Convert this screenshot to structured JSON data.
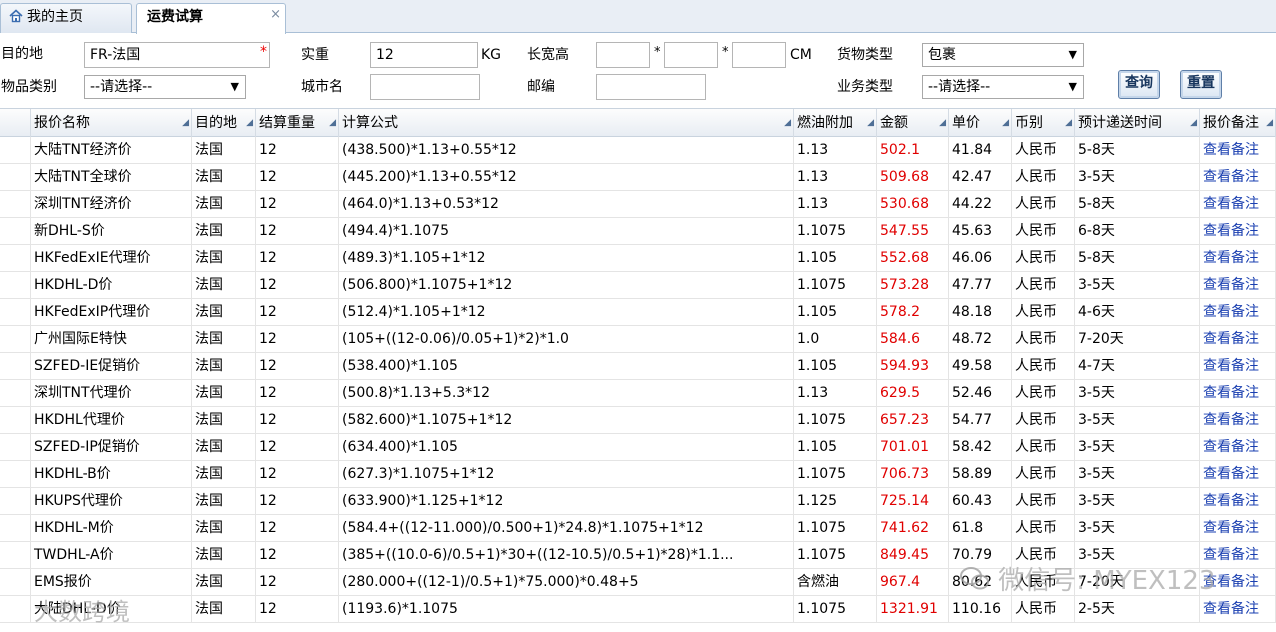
{
  "tabs": [
    {
      "label": "我的主页"
    },
    {
      "label": "运费试算",
      "close": "×"
    }
  ],
  "form": {
    "destination_label": "目的地",
    "destination_value": "FR-法国",
    "required_mark": "*",
    "weight_label": "实重",
    "weight_value": "12",
    "weight_unit": "KG",
    "dims_label": "长宽高",
    "dims_sep": "*",
    "dims_unit": "CM",
    "goods_type_label": "货物类型",
    "goods_type_value": "包裹",
    "item_category_label": "物品类别",
    "item_category_value": "--请选择--",
    "city_label": "城市名",
    "postcode_label": "邮编",
    "business_type_label": "业务类型",
    "business_type_value": "--请选择--",
    "query_button": "查询",
    "reset_button": "重置",
    "select_arrow": "▼"
  },
  "table": {
    "columns": [
      "报价名称",
      "目的地",
      "结算重量",
      "计算公式",
      "燃油附加",
      "金额",
      "单价",
      "币别",
      "预计递送时间",
      "报价备注"
    ],
    "sort_glyph": "◢",
    "rows": [
      [
        "大陆TNT经济价",
        "法国",
        "12",
        "(438.500)*1.13+0.55*12",
        "1.13",
        "502.1",
        "41.84",
        "人民币",
        "5-8天",
        "查看备注"
      ],
      [
        "大陆TNT全球价",
        "法国",
        "12",
        "(445.200)*1.13+0.55*12",
        "1.13",
        "509.68",
        "42.47",
        "人民币",
        "3-5天",
        "查看备注"
      ],
      [
        "深圳TNT经济价",
        "法国",
        "12",
        "(464.0)*1.13+0.53*12",
        "1.13",
        "530.68",
        "44.22",
        "人民币",
        "5-8天",
        "查看备注"
      ],
      [
        "新DHL-S价",
        "法国",
        "12",
        "(494.4)*1.1075",
        "1.1075",
        "547.55",
        "45.63",
        "人民币",
        "6-8天",
        "查看备注"
      ],
      [
        "HKFedExIE代理价",
        "法国",
        "12",
        "(489.3)*1.105+1*12",
        "1.105",
        "552.68",
        "46.06",
        "人民币",
        "5-8天",
        "查看备注"
      ],
      [
        "HKDHL-D价",
        "法国",
        "12",
        "(506.800)*1.1075+1*12",
        "1.1075",
        "573.28",
        "47.77",
        "人民币",
        "3-5天",
        "查看备注"
      ],
      [
        "HKFedExIP代理价",
        "法国",
        "12",
        "(512.4)*1.105+1*12",
        "1.105",
        "578.2",
        "48.18",
        "人民币",
        "4-6天",
        "查看备注"
      ],
      [
        "广州国际E特快",
        "法国",
        "12",
        "(105+((12-0.06)/0.05+1)*2)*1.0",
        "1.0",
        "584.6",
        "48.72",
        "人民币",
        "7-20天",
        "查看备注"
      ],
      [
        "SZFED-IE促销价",
        "法国",
        "12",
        "(538.400)*1.105",
        "1.105",
        "594.93",
        "49.58",
        "人民币",
        "4-7天",
        "查看备注"
      ],
      [
        "深圳TNT代理价",
        "法国",
        "12",
        "(500.8)*1.13+5.3*12",
        "1.13",
        "629.5",
        "52.46",
        "人民币",
        "3-5天",
        "查看备注"
      ],
      [
        "HKDHL代理价",
        "法国",
        "12",
        "(582.600)*1.1075+1*12",
        "1.1075",
        "657.23",
        "54.77",
        "人民币",
        "3-5天",
        "查看备注"
      ],
      [
        "SZFED-IP促销价",
        "法国",
        "12",
        "(634.400)*1.105",
        "1.105",
        "701.01",
        "58.42",
        "人民币",
        "3-5天",
        "查看备注"
      ],
      [
        "HKDHL-B价",
        "法国",
        "12",
        "(627.3)*1.1075+1*12",
        "1.1075",
        "706.73",
        "58.89",
        "人民币",
        "3-5天",
        "查看备注"
      ],
      [
        "HKUPS代理价",
        "法国",
        "12",
        "(633.900)*1.125+1*12",
        "1.125",
        "725.14",
        "60.43",
        "人民币",
        "3-5天",
        "查看备注"
      ],
      [
        "HKDHL-M价",
        "法国",
        "12",
        "(584.4+((12-11.000)/0.500+1)*24.8)*1.1075+1*12",
        "1.1075",
        "741.62",
        "61.8",
        "人民币",
        "3-5天",
        "查看备注"
      ],
      [
        "TWDHL-A价",
        "法国",
        "12",
        "(385+((10.0-6)/0.5+1)*30+((12-10.5)/0.5+1)*28)*1.1...",
        "1.1075",
        "849.45",
        "70.79",
        "人民币",
        "3-5天",
        "查看备注"
      ],
      [
        "EMS报价",
        "法国",
        "12",
        "(280.000+((12-1)/0.5+1)*75.000)*0.48+5",
        "含燃油",
        "967.4",
        "80.62",
        "人民币",
        "7-20天",
        "查看备注"
      ],
      [
        "大陆DHL-D价",
        "法国",
        "12",
        "(1193.6)*1.1075",
        "1.1075",
        "1321.91",
        "110.16",
        "人民币",
        "2-5天",
        "查看备注"
      ]
    ]
  },
  "watermarks": {
    "right": "微信号: MYEX123",
    "left": "大数跨境"
  },
  "colors": {
    "amount": "#e00000",
    "link": "#1a3fb0",
    "required": "#ee0000"
  }
}
